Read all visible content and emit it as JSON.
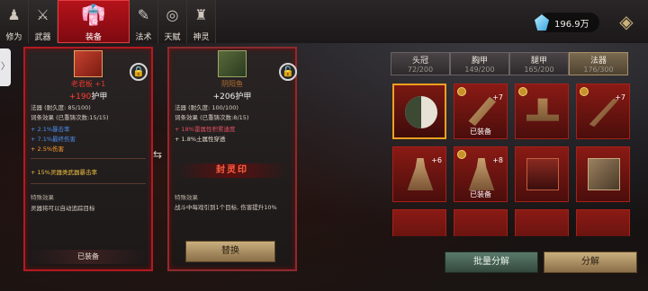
{
  "tabs": [
    {
      "label": "修为",
      "icon": "cultivator-icon"
    },
    {
      "label": "武器",
      "icon": "sword-icon"
    },
    {
      "label": "装备",
      "icon": "robe-icon"
    },
    {
      "label": "法术",
      "icon": "scroll-icon"
    },
    {
      "label": "天赋",
      "icon": "spiral-icon"
    },
    {
      "label": "神灵",
      "icon": "totem-icon"
    }
  ],
  "resource": {
    "amount": "196.9万",
    "icon": "crystal-icon"
  },
  "left_card": {
    "name": "老君板 +1",
    "stat_value": "+190",
    "stat_label": "护甲",
    "durability_label": "法器",
    "durability": "(耐久度: 85/100)",
    "affix_label": "词条效果",
    "affix_count": "(已重铸次数:15/15)",
    "affixes": [
      "+ 2.1%暴击率",
      "+ 7.1%最终伤害",
      "+ 2.5%伤害"
    ],
    "special": "+ 15%灵器类武器暴击率",
    "special_title": "特殊效果",
    "special_text": "灵器将可以自动追踪目标",
    "footer": "已装备"
  },
  "right_card": {
    "name": "阴阳鱼",
    "stat_value": "+206",
    "stat_label": "护甲",
    "durability_label": "法器",
    "durability": "(耐久度: 100/100)",
    "affix_label": "词条效果",
    "affix_count": "(已重铸次数:8/15)",
    "affixes": [
      "+ 18%雷属性积累速度",
      "+ 1.8%土属性穿透"
    ],
    "seal": "封灵印",
    "special_title": "特殊效果",
    "special_text": "战斗中每戏引到1个目标, 伤害提升10%",
    "button": "替换"
  },
  "slot_tabs": [
    {
      "name": "头冠",
      "count": "72/200"
    },
    {
      "name": "胸甲",
      "count": "149/200"
    },
    {
      "name": "腿甲",
      "count": "165/200"
    },
    {
      "name": "法器",
      "count": "176/300"
    }
  ],
  "items": [
    {
      "plus": "",
      "equipped": ""
    },
    {
      "plus": "+7",
      "equipped": "已装备"
    },
    {
      "plus": "",
      "equipped": ""
    },
    {
      "plus": "+7",
      "equipped": ""
    },
    {
      "plus": "+6",
      "equipped": ""
    },
    {
      "plus": "+8",
      "equipped": "已装备"
    },
    {
      "plus": "",
      "equipped": ""
    },
    {
      "plus": "",
      "equipped": ""
    }
  ],
  "buttons": {
    "batch": "批量分解",
    "decompose": "分解"
  }
}
